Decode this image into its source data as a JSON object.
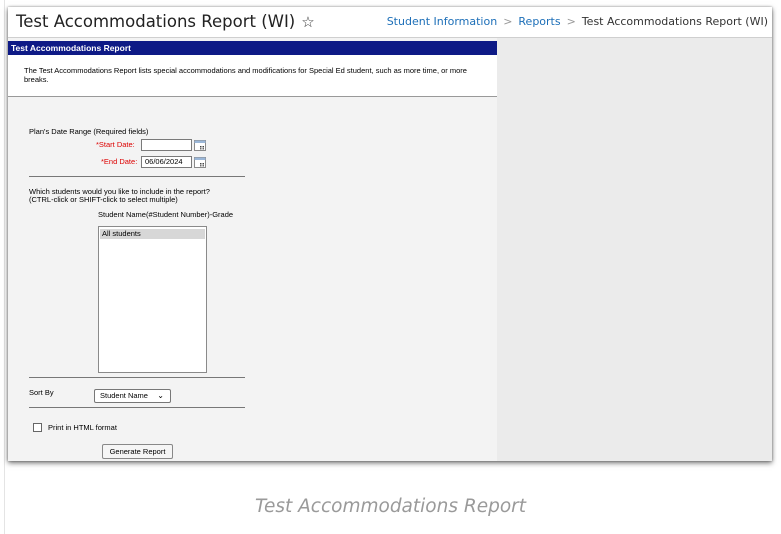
{
  "header": {
    "title": "Test Accommodations Report (WI)",
    "star_icon": "☆",
    "breadcrumb": [
      "Student Information",
      "Reports",
      "Test Accommodations Report (WI)"
    ]
  },
  "report": {
    "bar_title": "Test Accommodations Report",
    "description": "The Test Accommodations Report lists special accommodations and modifications for Special Ed student, such as more time, or more breaks."
  },
  "date_range": {
    "label": "Plan's Date Range (Required fields)",
    "start_label": "*Start Date:",
    "start_value": "",
    "end_label": "*End Date:",
    "end_value": "06/06/2024"
  },
  "students": {
    "prompt_line1": "Which students would you like to include in the report?",
    "prompt_line2": "(CTRL-click or SHIFT-click to select multiple)",
    "column_header": "Student Name(#Student Number)-Grade",
    "items": [
      "All students"
    ]
  },
  "sort": {
    "label": "Sort By",
    "selected": "Student Name"
  },
  "print_html": {
    "label": "Print in HTML format",
    "checked": false
  },
  "generate_button": "Generate Report",
  "caption": "Test Accommodations Report"
}
